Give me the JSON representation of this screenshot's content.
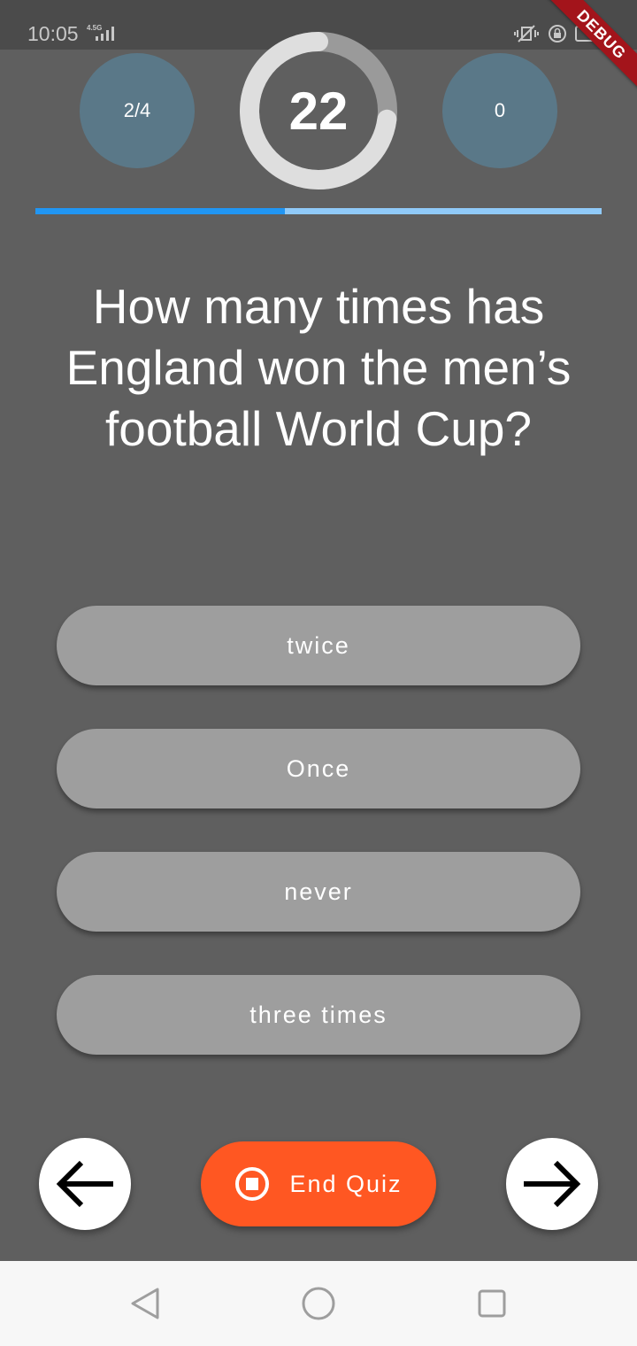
{
  "status_bar": {
    "time": "10:05",
    "network": "4.5G"
  },
  "debug_banner": "DEBUG",
  "header": {
    "question_counter": "2/4",
    "timer_value": "22",
    "timer_fraction_remaining": 0.73,
    "score": "0",
    "progress_fraction": 0.44
  },
  "question": {
    "text": "How many times has England won the men’s football World Cup?"
  },
  "answers": [
    {
      "label": "twice"
    },
    {
      "label": "Once"
    },
    {
      "label": "never"
    },
    {
      "label": "three times"
    }
  ],
  "controls": {
    "end_quiz_label": "End Quiz",
    "back_icon": "arrow-left-icon",
    "forward_icon": "arrow-right-icon",
    "stop_icon": "stop-circle-icon"
  },
  "colors": {
    "background": "#5f5f5f",
    "stat_circle": "#5a7888",
    "progress_fill": "#2196f3",
    "progress_track": "#90caf9",
    "answer_button": "#9e9e9e",
    "end_quiz_button": "#ff5722",
    "debug_banner": "#a3141b"
  }
}
